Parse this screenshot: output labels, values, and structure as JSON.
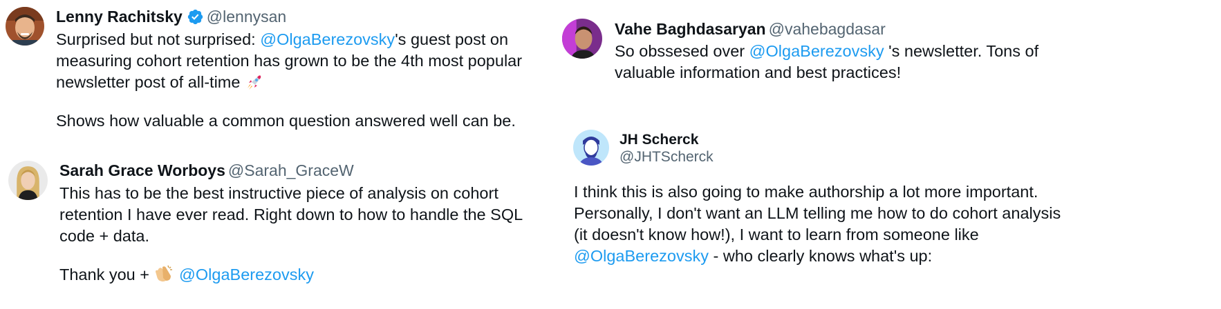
{
  "tweets": [
    {
      "name": "Lenny Rachitsky",
      "handle": "@lennysan",
      "verified": true,
      "text_a": "Surprised but not surprised: ",
      "mention_a": "@OlgaBerezovsky",
      "text_b": "'s guest post on measuring cohort retention has grown to be the 4th most popular newsletter post of all-time ",
      "emoji": "rocket",
      "text_c": "Shows how valuable a common question answered well can be."
    },
    {
      "name": "Sarah Grace Worboys",
      "handle": "@Sarah_GraceW",
      "text_a": "This has to be the best instructive piece of analysis on cohort retention I have ever read. Right down to how to handle the SQL code + data.",
      "text_b": "Thank you + ",
      "emoji": "clapping-hands",
      "mention_a": "@OlgaBerezovsky"
    },
    {
      "name": "Vahe Baghdasaryan",
      "handle": "@vahebagdasar",
      "text_a": "So obssesed over ",
      "mention_a": "@OlgaBerezovsky",
      "text_b": " 's newsletter. Tons of valuable information and best practices!"
    },
    {
      "name": "JH Scherck",
      "handle": "@JHTScherck",
      "text_a": "I think this is also going to make authorship a lot more important. Personally, I don't want an LLM telling me how to do cohort analysis (it doesn't know how!), I want to learn from someone like ",
      "mention_a": "@OlgaBerezovsky",
      "text_b": " - who clearly knows what's up:"
    }
  ],
  "colors": {
    "mention": "#1d9bf0",
    "text": "#0f1419",
    "secondary": "#536471",
    "verified": "#1d9bf0"
  }
}
